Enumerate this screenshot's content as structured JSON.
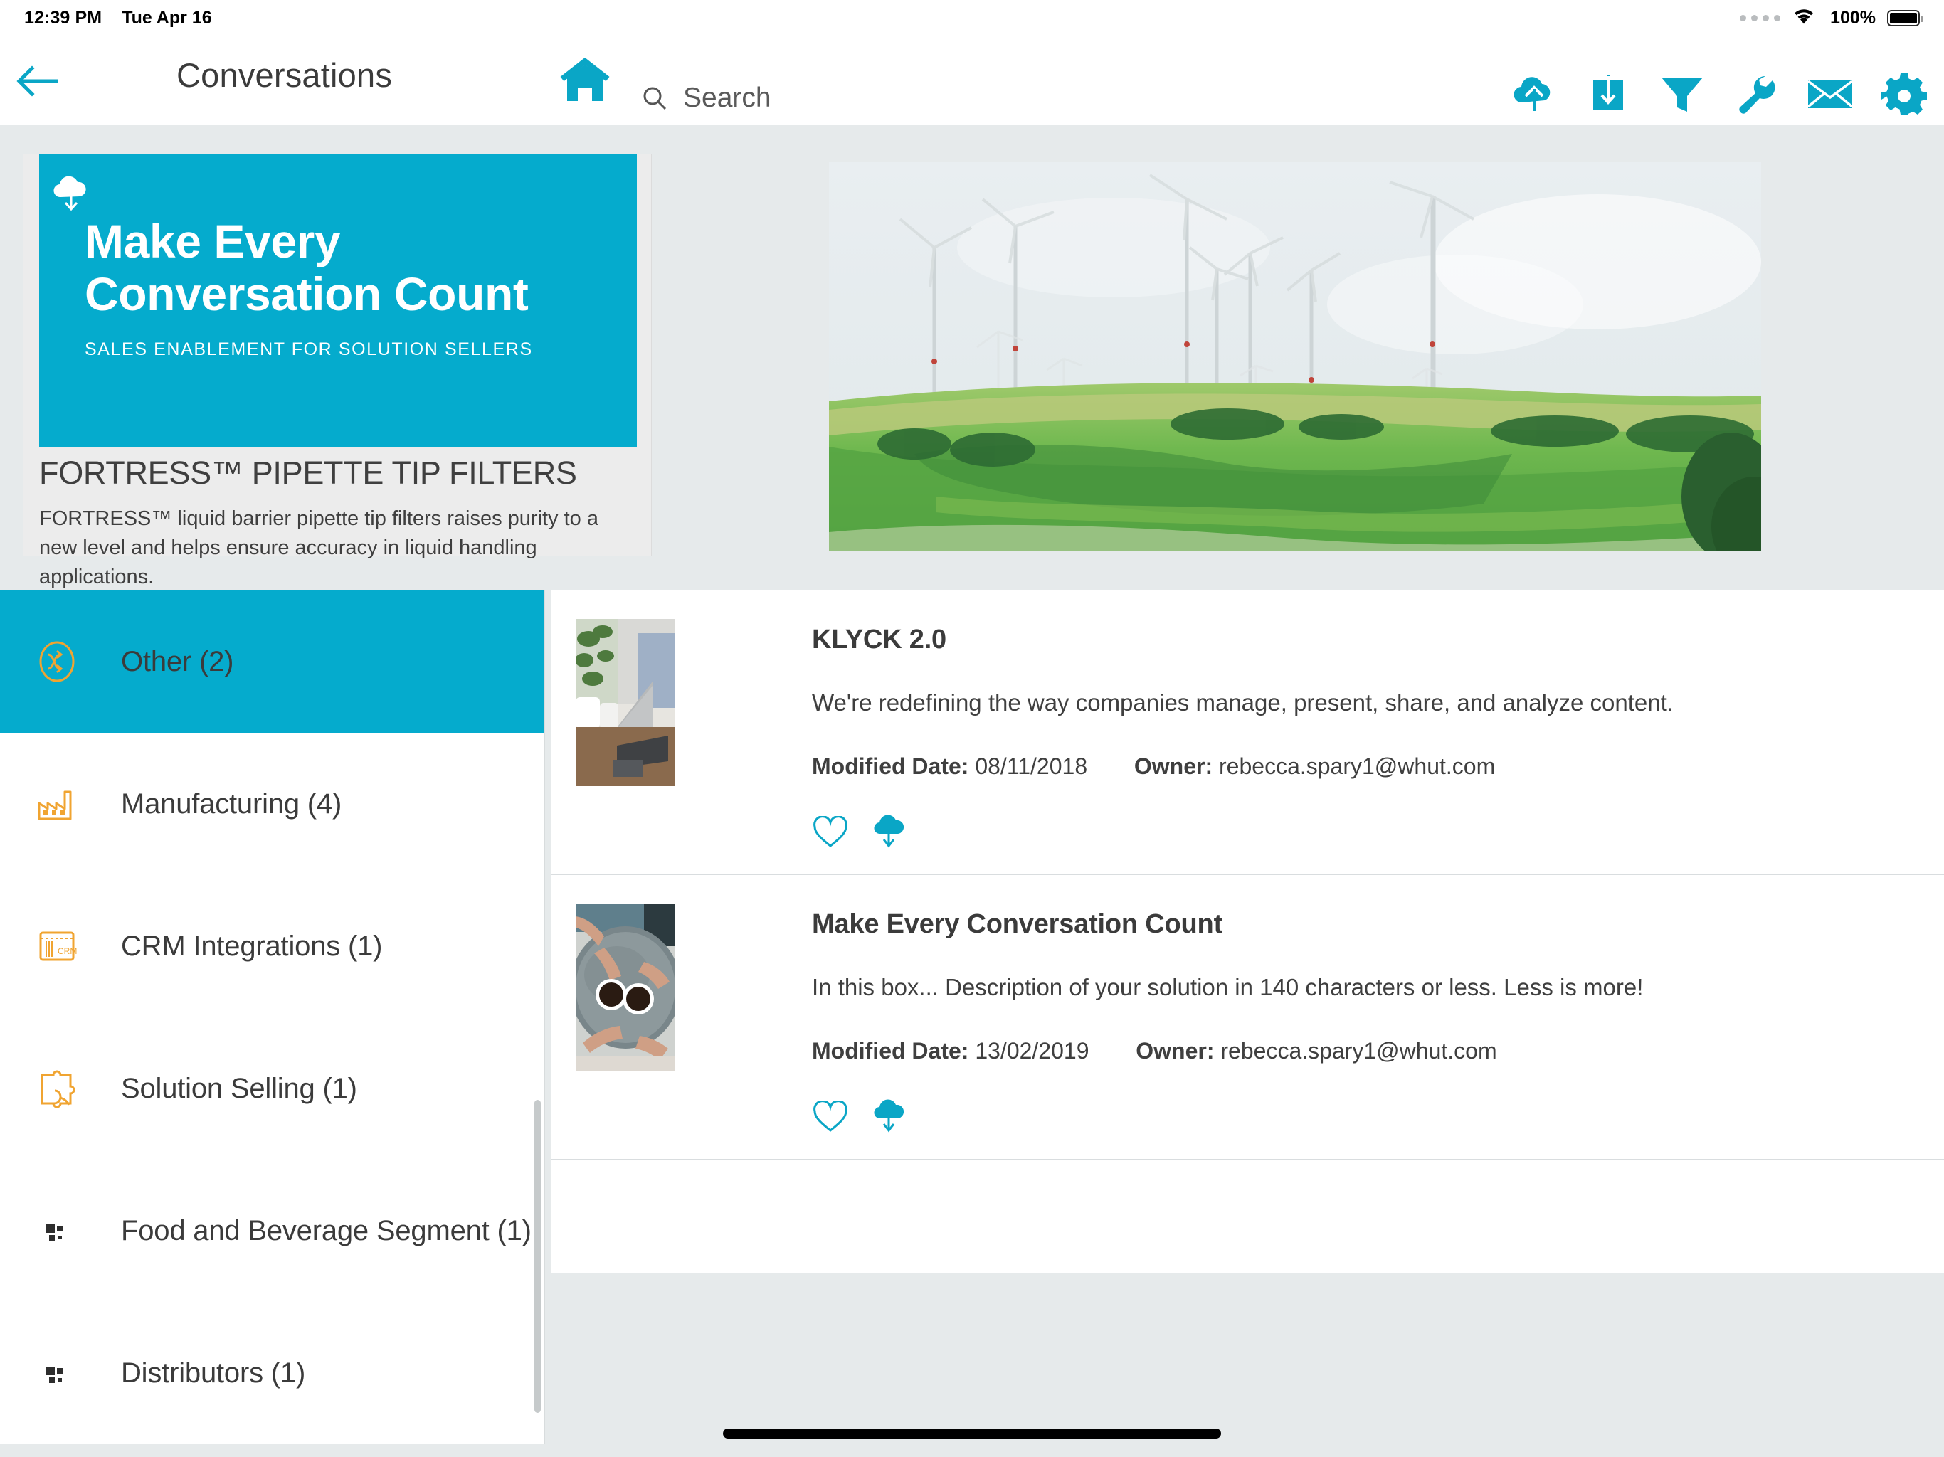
{
  "status_bar": {
    "time": "12:39 PM",
    "date": "Tue Apr 16",
    "battery_percent": "100%",
    "wifi_icon": "wifi-icon",
    "battery_icon": "battery-full-icon",
    "dots_icon": "signal-dots-icon"
  },
  "header": {
    "back_icon": "back-arrow-icon",
    "title": "Conversations",
    "home_icon": "home-icon",
    "search": {
      "icon": "search-icon",
      "value": "",
      "placeholder": "Search"
    },
    "toolbar": [
      {
        "name": "cloud-upload-icon",
        "label": "Upload"
      },
      {
        "name": "download-box-icon",
        "label": "Download"
      },
      {
        "name": "filter-icon",
        "label": "Filter"
      },
      {
        "name": "wrench-icon",
        "label": "Tools"
      },
      {
        "name": "envelope-icon",
        "label": "Messages"
      },
      {
        "name": "gear-icon",
        "label": "Settings"
      }
    ]
  },
  "promo": {
    "cloud_icon": "cloud-download-icon",
    "banner_heading_line1": "Make Every",
    "banner_heading_line2": "Conversation Count",
    "banner_subtitle": "SALES ENABLEMENT FOR SOLUTION SELLERS",
    "title": "FORTRESS™ PIPETTE TIP FILTERS",
    "description": "FORTRESS™ liquid barrier pipette tip filters raises purity to a new level and helps ensure accuracy in liquid handling applications.",
    "accent_color": "#05abcd"
  },
  "hero": {
    "alt": "wind-turbines-on-green-farmland-photo"
  },
  "sidebar": {
    "items": [
      {
        "label": "Other (2)",
        "icon": "shuffle-arrows-icon",
        "active": true
      },
      {
        "label": "Manufacturing (4)",
        "icon": "factory-icon",
        "active": false
      },
      {
        "label": "CRM Integrations (1)",
        "icon": "crm-card-icon",
        "active": false
      },
      {
        "label": "Solution Selling (1)",
        "icon": "puzzle-piece-icon",
        "active": false
      },
      {
        "label": "Food and Beverage Segment (1)",
        "icon": "blocks-icon",
        "active": false
      },
      {
        "label": "Distributors (1)",
        "icon": "blocks-icon",
        "active": false
      }
    ]
  },
  "content_list": {
    "meta_labels": {
      "modified_date": "Modified Date:",
      "owner": "Owner:"
    },
    "items": [
      {
        "title": "KLYCK 2.0",
        "description": "We're redefining the way companies manage, present, share, and analyze content.",
        "modified_date": "08/11/2018",
        "owner": "rebecca.spary1@whut.com",
        "thumbnail": "laptop-with-plants-photo",
        "favorite_icon": "heart-outline-icon",
        "download_icon": "cloud-download-icon"
      },
      {
        "title": "Make Every Conversation Count",
        "description": "In this box... Description of your solution in 140 characters or less. Less is more!",
        "modified_date": "13/02/2019",
        "owner": "rebecca.spary1@whut.com",
        "thumbnail": "hands-holding-coffee-cups-photo",
        "favorite_icon": "heart-outline-icon",
        "download_icon": "cloud-download-icon"
      }
    ]
  },
  "colors": {
    "accent": "#05abcd",
    "icon_orange": "#f0a431",
    "page_background": "#e6eaeb",
    "text": "#3b3b3b"
  }
}
